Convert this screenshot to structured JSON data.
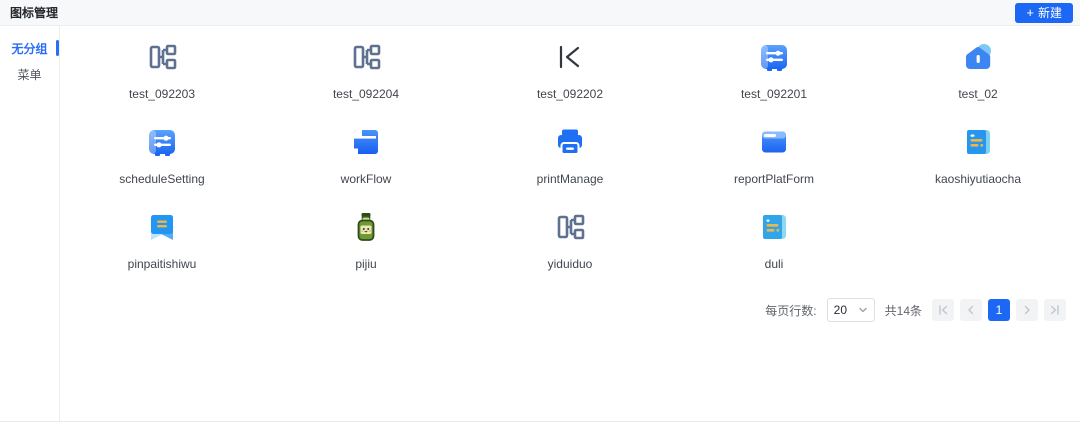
{
  "header": {
    "title": "图标管理",
    "new_button": {
      "icon": "+",
      "label": "新建"
    }
  },
  "sidebar": {
    "items": [
      {
        "label": "无分组",
        "active": true
      },
      {
        "label": "菜单",
        "active": false
      }
    ]
  },
  "icons": [
    {
      "label": "test_092203",
      "icon": "component-icon"
    },
    {
      "label": "test_092204",
      "icon": "component-icon"
    },
    {
      "label": "test_092202",
      "icon": "skip-back-icon"
    },
    {
      "label": "test_092201",
      "icon": "sliders-icon"
    },
    {
      "label": "test_02",
      "icon": "house-icon"
    },
    {
      "label": "scheduleSetting",
      "icon": "sliders-icon"
    },
    {
      "label": "workFlow",
      "icon": "workflow-folder-icon"
    },
    {
      "label": "printManage",
      "icon": "printer-icon"
    },
    {
      "label": "reportPlatForm",
      "icon": "report-card-icon"
    },
    {
      "label": "kaoshiyutiaocha",
      "icon": "scroll-icon"
    },
    {
      "label": "pinpaitishiwu",
      "icon": "bookmark-ribbon-icon"
    },
    {
      "label": "pijiu",
      "icon": "beer-bottle-icon"
    },
    {
      "label": "yiduiduo",
      "icon": "component-icon"
    },
    {
      "label": "duli",
      "icon": "scroll-light-icon"
    }
  ],
  "pagination": {
    "rows_per_page_label": "每页行数:",
    "page_size": "20",
    "total_label": "共14条",
    "current_page": "1"
  },
  "colors": {
    "primary": "#1c68f5",
    "sidebar_active": "#2a6ef5",
    "component_icon": "#5e7191"
  }
}
